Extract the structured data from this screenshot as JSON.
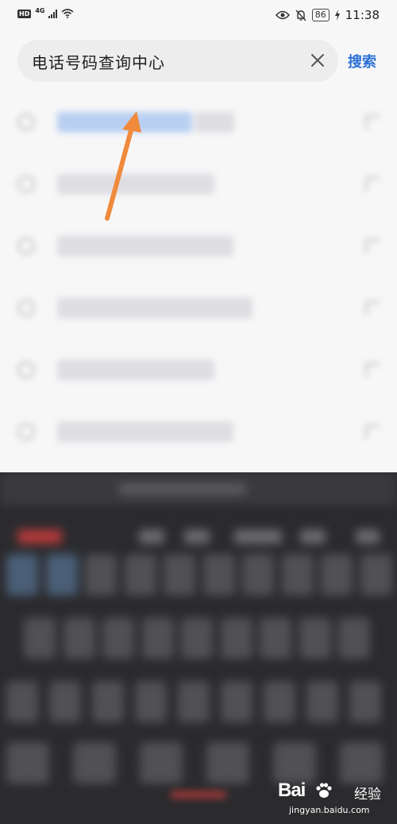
{
  "status_bar": {
    "hd_label": "HD",
    "network_label": "4G",
    "battery": "86",
    "time": "11:38",
    "icons": [
      "signal-icon",
      "wifi-icon",
      "eye-icon",
      "mute-bell-icon",
      "charging-icon"
    ]
  },
  "search": {
    "query": "电话号码查询中心",
    "submit_label": "搜索",
    "clear_icon": "close-icon",
    "accent_color": "#2a6fd6"
  },
  "suggestions": {
    "count": 6,
    "icon": "search-icon",
    "fill_icon": "arrow-up-left-icon"
  },
  "annotation": {
    "type": "arrow",
    "color": "#f08a3c"
  },
  "watermark": {
    "brand": "Bai",
    "brand_suffix": "经验",
    "url": "jingyan.baidu.com"
  }
}
